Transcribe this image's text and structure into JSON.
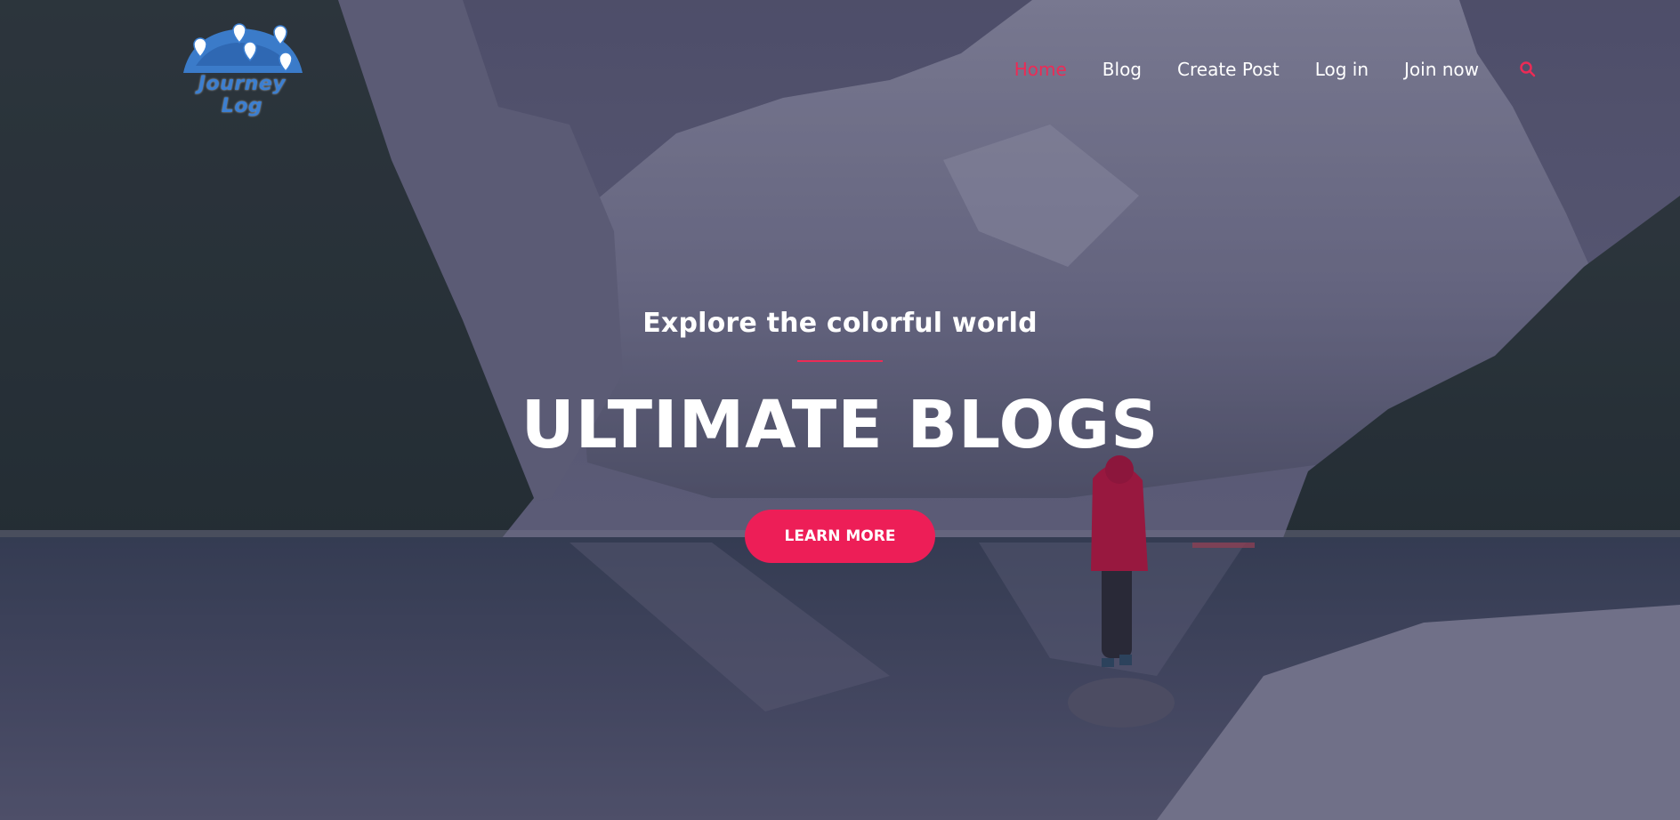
{
  "brand": {
    "logo_text": "Journey Log",
    "logo_color": "#3c7fd1"
  },
  "nav": {
    "items": [
      {
        "label": "Home",
        "active": true
      },
      {
        "label": "Blog"
      },
      {
        "label": "Create Post"
      },
      {
        "label": "Log in"
      },
      {
        "label": "Join now"
      }
    ],
    "search_icon": "search-icon",
    "accent_color": "#ec2b56"
  },
  "hero": {
    "subtitle": "Explore the colorful world",
    "headline": "ULTIMATE BLOGS",
    "cta_label": "LEARN MORE",
    "cta_color": "#ed1e57",
    "background": "mountain-lake-photo"
  }
}
